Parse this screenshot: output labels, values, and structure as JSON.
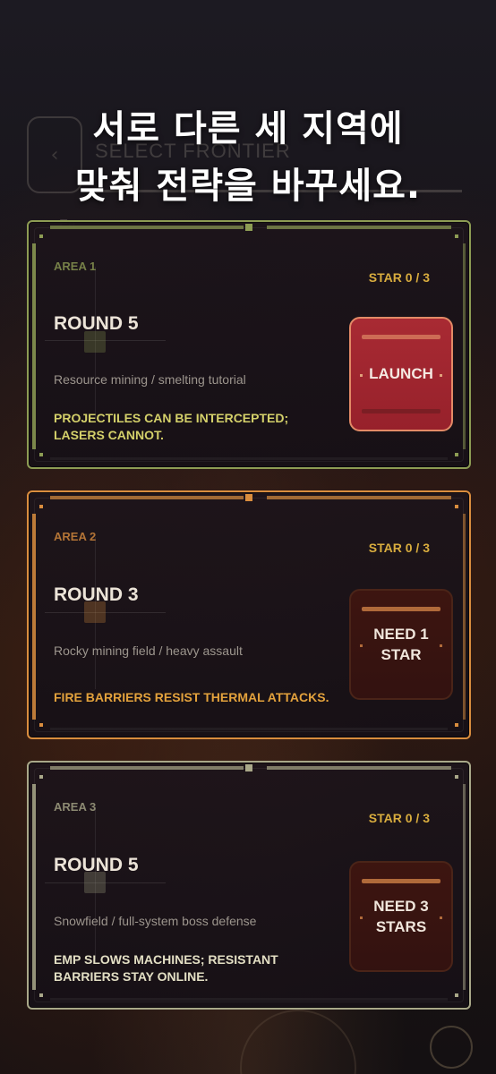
{
  "background": {
    "title": "SELECT FRONTIER",
    "subtitle": "Ea",
    "back_icon": "chevron-left-icon"
  },
  "headline": {
    "line1": "서로 다른 세 지역에",
    "line2": "맞춰 전략을 바꾸세요."
  },
  "areas": [
    {
      "area": "AREA 1",
      "stars": "STAR 0 / 3",
      "round": "ROUND 5",
      "description": "Resource mining / smelting tutorial",
      "tip": "PROJECTILES CAN BE INTERCEPTED; LASERS CANNOT.",
      "button": "LAUNCH",
      "accent": "#8d9c54",
      "tip_color": "#d4d06a"
    },
    {
      "area": "AREA 2",
      "stars": "STAR 0 / 3",
      "round": "ROUND 3",
      "description": "Rocky mining field / heavy assault",
      "tip": "FIRE BARRIERS RESIST THERMAL ATTACKS.",
      "button": "NEED 1\nSTAR",
      "accent": "#d98d3e",
      "tip_color": "#e3a23c"
    },
    {
      "area": "AREA 3",
      "stars": "STAR 0 / 3",
      "round": "ROUND 5",
      "description": "Snowfield / full-system boss defense",
      "tip": "EMP SLOWS MACHINES; RESISTANT BARRIERS STAY ONLINE.",
      "button": "NEED 3\nSTARS",
      "accent": "#a9a889",
      "tip_color": "#e3dfc4"
    }
  ]
}
